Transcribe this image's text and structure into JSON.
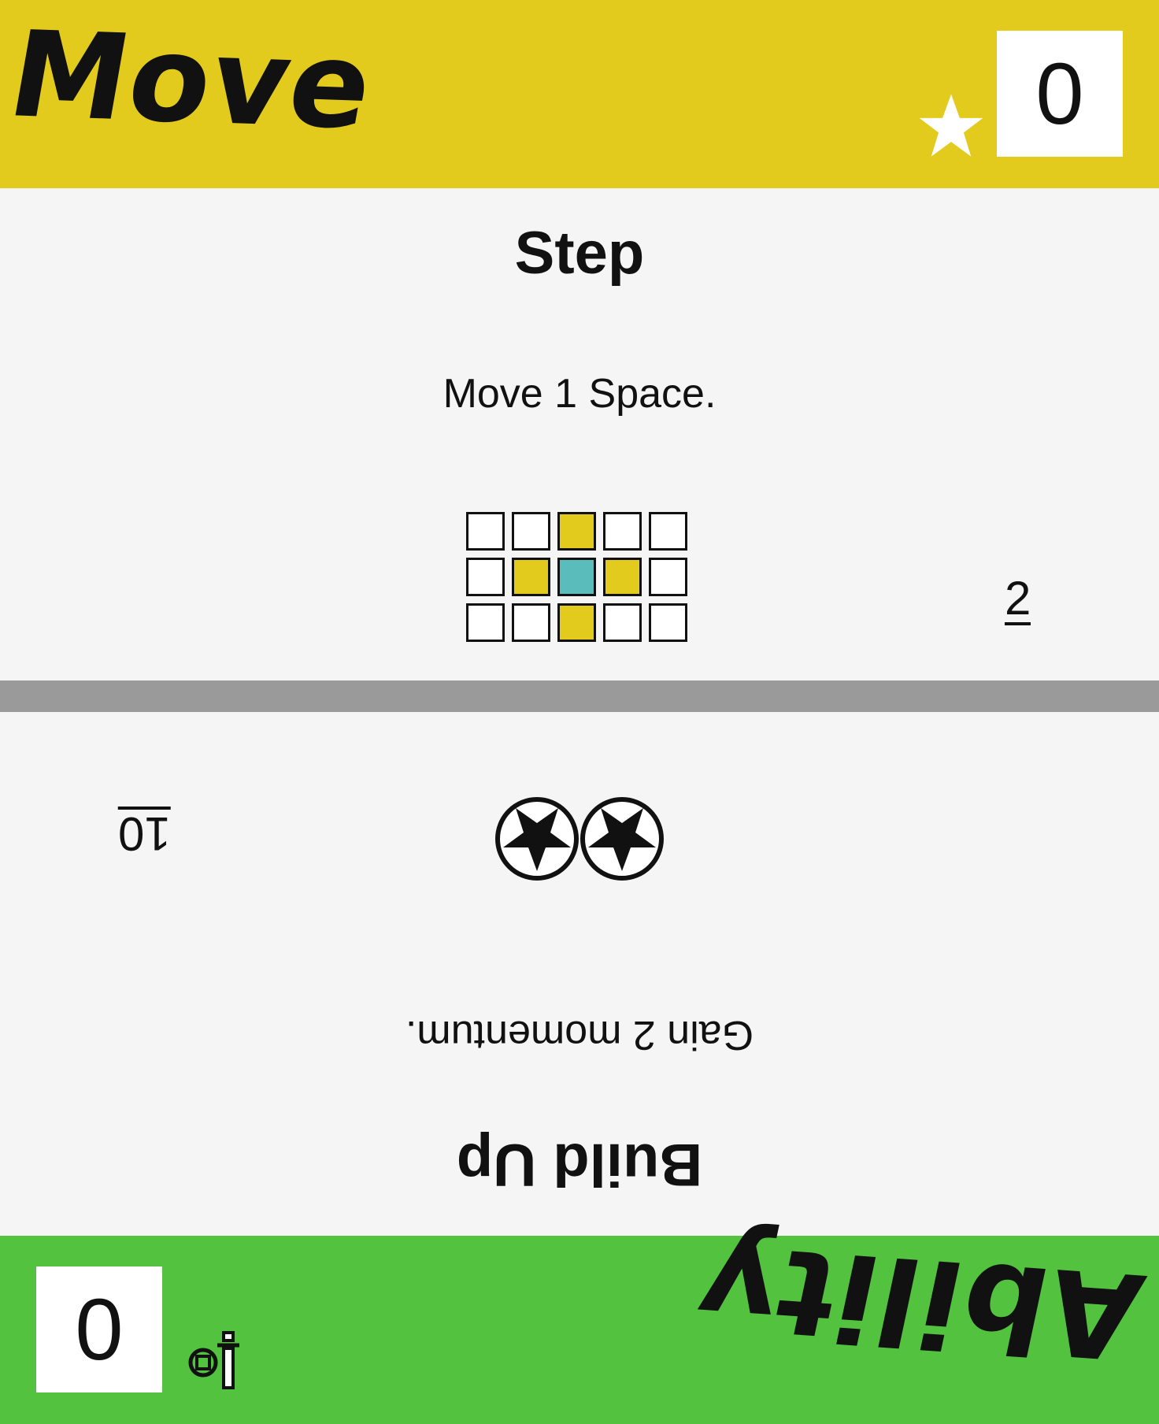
{
  "top": {
    "type_label": "Move",
    "band_color": "#e2cb1c",
    "score": "0",
    "card_name": "Step",
    "card_text": "Move 1 Space.",
    "cost": "2",
    "grid": [
      [
        "empty",
        "empty",
        "target",
        "empty",
        "empty"
      ],
      [
        "empty",
        "target",
        "origin",
        "target",
        "empty"
      ],
      [
        "empty",
        "empty",
        "target",
        "empty",
        "empty"
      ]
    ],
    "grid_colors": {
      "empty": "#ffffff",
      "target": "#e2cb1c",
      "origin": "#5bbcbc"
    },
    "icon": "star-icon"
  },
  "bottom": {
    "type_label": "Ability",
    "band_color": "#52c23f",
    "score": "0",
    "card_name": "Build Up",
    "card_text": "Gain 2 momentum.",
    "cost": "10",
    "momentum_count": 2,
    "icon": "sword-icon"
  },
  "divider_color": "#9a9a9a"
}
